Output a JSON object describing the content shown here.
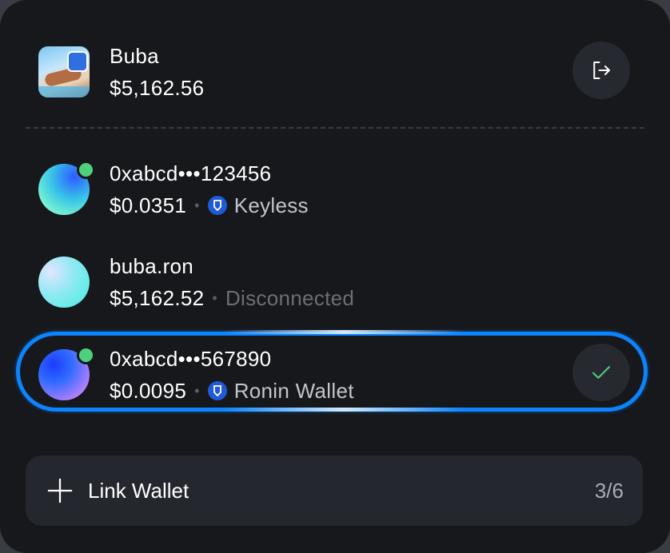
{
  "account": {
    "name": "Buba",
    "balance": "$5,162.56"
  },
  "wallets": [
    {
      "name": "0xabcd•••123456",
      "balance": "$0.0351",
      "provider": "Keyless"
    },
    {
      "name": "buba.ron",
      "balance": "$5,162.52",
      "provider": "Disconnected"
    },
    {
      "name": "0xabcd•••567890",
      "balance": "$0.0095",
      "provider": "Ronin Wallet"
    }
  ],
  "separator": "•",
  "link_wallet": {
    "label": "Link Wallet",
    "count": "3/6"
  },
  "icons": [
    "logout-icon",
    "check-icon",
    "plus-icon",
    "ronin-logo-icon"
  ],
  "colors": {
    "background": "#17181c",
    "accent": "#0a84ff",
    "online": "#4fd07b",
    "badge": "#1f5bd6"
  }
}
